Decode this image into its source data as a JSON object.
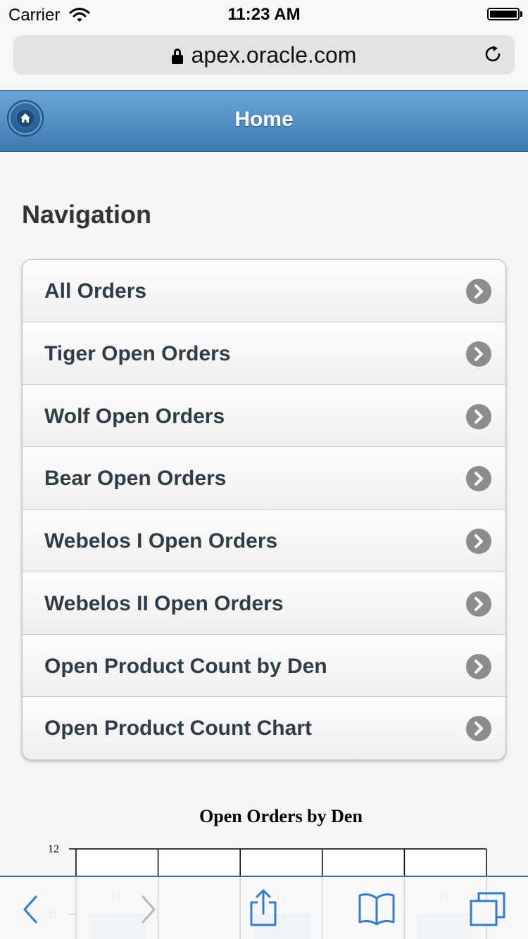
{
  "status_bar": {
    "carrier": "Carrier",
    "time": "11:23 AM"
  },
  "browser": {
    "url": "apex.oracle.com"
  },
  "header": {
    "title": "Home"
  },
  "navigation": {
    "title": "Navigation",
    "items": [
      {
        "label": "All Orders"
      },
      {
        "label": "Tiger Open Orders"
      },
      {
        "label": "Wolf Open Orders"
      },
      {
        "label": "Bear Open Orders"
      },
      {
        "label": "Webelos I Open Orders"
      },
      {
        "label": "Webelos II Open Orders"
      },
      {
        "label": "Open Product Count by Den"
      },
      {
        "label": "Open Product Count Chart"
      }
    ]
  },
  "chart_data": {
    "type": "bar",
    "title": "Open Orders by Den",
    "y_tick_labels": [
      "12",
      "11"
    ],
    "data_labels": [
      "11",
      "11",
      "11"
    ],
    "grid": true
  },
  "colors": {
    "header_top": "#6aa6d6",
    "header_bottom": "#3d78b1",
    "toolbar_accent": "#2f7bd5",
    "chevron": "#8c8c8c"
  }
}
